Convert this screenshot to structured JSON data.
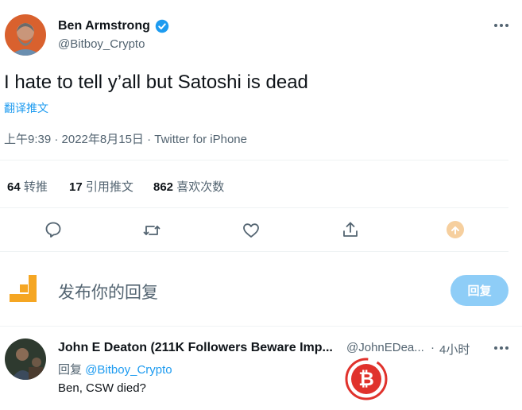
{
  "tweet": {
    "author_name": "Ben Armstrong",
    "author_handle": "@Bitboy_Crypto",
    "text": "I hate to tell y’all but Satoshi is dead",
    "translate": "翻译推文",
    "meta": "上午9:39 · 2022年8月15日 · Twitter for iPhone",
    "stats": {
      "retweets_count": "64",
      "retweets_label": "转推",
      "quotes_count": "17",
      "quotes_label": "引用推文",
      "likes_count": "862",
      "likes_label": "喜欢次数"
    },
    "more_icon": "ellipsis-icon",
    "verified_icon": "verified-badge-icon"
  },
  "actions": {
    "icons": [
      "reply-icon",
      "retweet-icon",
      "like-icon",
      "share-icon",
      "tip-icon"
    ]
  },
  "compose": {
    "placeholder": "发布你的回复",
    "button": "回复"
  },
  "reply": {
    "author_name": "John E Deaton (211K Followers Beware Imp...",
    "author_handle": "@JohnEDea...",
    "time": "4小时",
    "replying_prefix": "回复",
    "replying_to": "@Bitboy_Crypto",
    "text": "Ben, CSW died?"
  },
  "colors": {
    "accent": "#1d9bf0",
    "reply_button": "#8ecdf7",
    "watermark": "#e0322c",
    "compose_logo": "#f5a623"
  }
}
